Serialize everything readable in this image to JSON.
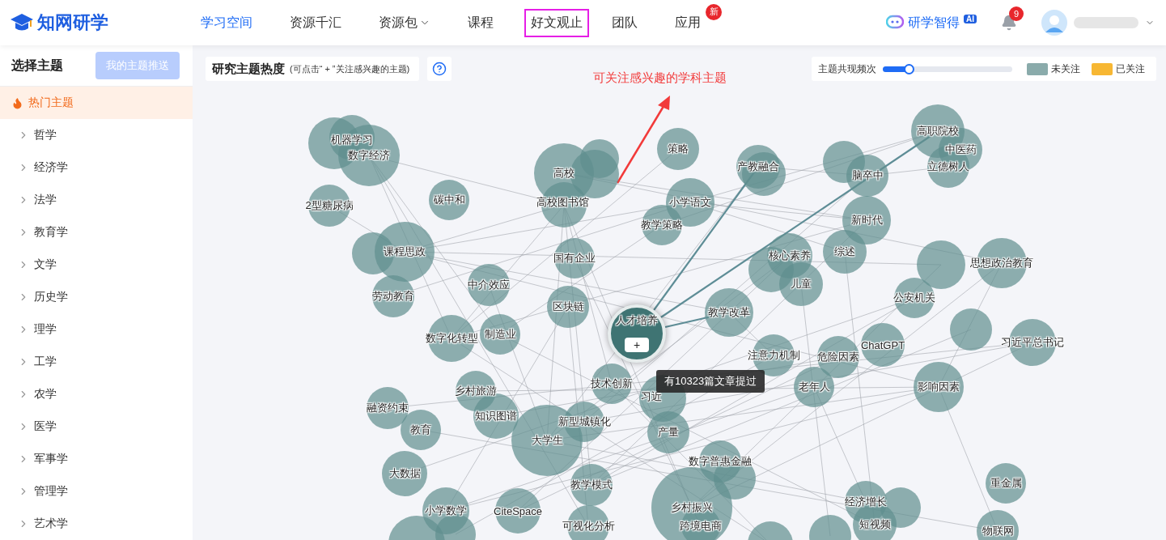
{
  "header": {
    "logo": "知网研学",
    "nav": [
      {
        "label": "学习空间",
        "selected": true,
        "outlined": false
      },
      {
        "label": "资源千汇",
        "selected": false,
        "outlined": false
      },
      {
        "label": "资源包",
        "selected": false,
        "outlined": false,
        "dropdown": true
      },
      {
        "label": "课程",
        "selected": false,
        "outlined": false
      },
      {
        "label": "好文观止",
        "selected": false,
        "outlined": true
      },
      {
        "label": "团队",
        "selected": false,
        "outlined": false
      },
      {
        "label": "应用",
        "selected": false,
        "outlined": false,
        "badge": "新"
      }
    ],
    "assistant": {
      "label": "研学智得",
      "badge": "AI"
    },
    "notifications": {
      "count": "9"
    }
  },
  "sidebar": {
    "title": "选择主题",
    "button": "我的主题推送",
    "items": [
      {
        "label": "热门主题",
        "selected": true,
        "kind": "hot"
      },
      {
        "label": "哲学",
        "selected": false,
        "kind": "category"
      },
      {
        "label": "经济学",
        "selected": false,
        "kind": "category"
      },
      {
        "label": "法学",
        "selected": false,
        "kind": "category"
      },
      {
        "label": "教育学",
        "selected": false,
        "kind": "category"
      },
      {
        "label": "文学",
        "selected": false,
        "kind": "category"
      },
      {
        "label": "历史学",
        "selected": false,
        "kind": "category"
      },
      {
        "label": "理学",
        "selected": false,
        "kind": "category"
      },
      {
        "label": "工学",
        "selected": false,
        "kind": "category"
      },
      {
        "label": "农学",
        "selected": false,
        "kind": "category"
      },
      {
        "label": "医学",
        "selected": false,
        "kind": "category"
      },
      {
        "label": "军事学",
        "selected": false,
        "kind": "category"
      },
      {
        "label": "管理学",
        "selected": false,
        "kind": "category"
      },
      {
        "label": "艺术学",
        "selected": false,
        "kind": "category"
      }
    ]
  },
  "graph": {
    "title": "研究主题热度",
    "hint": "(可点击“ + ”关注感兴趣的主题)",
    "slider": {
      "label": "主题共现频次",
      "level": 0.2
    },
    "legend": [
      {
        "label": "未关注",
        "color": "#8aabab"
      },
      {
        "label": "已关注",
        "color": "#f7b733"
      }
    ],
    "annotation": "可关注感兴趣的学科主题",
    "focus_node": {
      "label": "人才培养",
      "followed": false,
      "action": "+",
      "tooltip": "有10323篇文章提过"
    },
    "nodes": [
      {
        "label": "机器学习",
        "followed": false
      },
      {
        "followed": false
      },
      {
        "label": "数字经济",
        "followed": false
      },
      {
        "label": "2型糖尿病",
        "followed": false
      },
      {
        "label": "碳中和",
        "followed": false
      },
      {
        "label": "高校",
        "followed": false
      },
      {
        "followed": false
      },
      {
        "followed": false
      },
      {
        "label": "高校图书馆",
        "followed": false
      },
      {
        "label": "策略",
        "followed": false
      },
      {
        "label": "小学语文",
        "followed": false
      },
      {
        "label": "教学策略",
        "followed": false
      },
      {
        "label": "产教融合",
        "followed": false
      },
      {
        "followed": false
      },
      {
        "followed": false
      },
      {
        "label": "课程思政",
        "followed": false
      },
      {
        "label": "国有企业",
        "followed": false
      },
      {
        "label": "中介效应",
        "followed": false
      },
      {
        "label": "劳动教育",
        "followed": false
      },
      {
        "label": "区块链",
        "followed": false
      },
      {
        "label": "数字化转型",
        "followed": false
      },
      {
        "label": "制造业",
        "followed": false
      },
      {
        "label": "教学改革",
        "followed": false
      },
      {
        "followed": false
      },
      {
        "label": "核心素养",
        "followed": false
      },
      {
        "label": "儿童",
        "followed": false
      },
      {
        "followed": false
      },
      {
        "label": "脑卒中",
        "followed": false
      },
      {
        "label": "高职院校",
        "followed": false
      },
      {
        "label": "中医药",
        "followed": false
      },
      {
        "label": "立德树人",
        "followed": false
      },
      {
        "label": "新时代",
        "followed": false
      },
      {
        "label": "综述",
        "followed": false
      },
      {
        "followed": false
      },
      {
        "label": "思想政治教育",
        "followed": false
      },
      {
        "label": "公安机关",
        "followed": false
      },
      {
        "followed": false
      },
      {
        "label": "ChatGPT",
        "followed": false
      },
      {
        "label": "习近平总书记",
        "followed": false
      },
      {
        "label": "危险因素",
        "followed": false
      },
      {
        "label": "注意力机制",
        "followed": false
      },
      {
        "label": "乡村旅游",
        "followed": false
      },
      {
        "label": "技术创新",
        "followed": false
      },
      {
        "label": "习近",
        "followed": false
      },
      {
        "label": "老年人",
        "followed": false
      },
      {
        "label": "影响因素",
        "followed": false
      },
      {
        "label": "融资约束",
        "followed": false
      },
      {
        "label": "知识图谱",
        "followed": false
      },
      {
        "label": "教育",
        "followed": false
      },
      {
        "label": "大学生",
        "followed": false
      },
      {
        "label": "新型城镇化",
        "followed": false
      },
      {
        "label": "产量",
        "followed": false
      },
      {
        "label": "大数据",
        "followed": false
      },
      {
        "label": "教学模式",
        "followed": false
      },
      {
        "label": "数字普惠金融",
        "followed": false
      },
      {
        "followed": false
      },
      {
        "label": "重金属",
        "followed": false
      },
      {
        "label": "小学数学",
        "followed": false
      },
      {
        "followed": false
      },
      {
        "label": "CiteSpace",
        "followed": false
      },
      {
        "label": "可视化分析",
        "followed": false
      },
      {
        "label": "乡村振兴",
        "followed": false
      },
      {
        "label": "跨境电商",
        "followed": false
      },
      {
        "label": "经济增长",
        "followed": false
      },
      {
        "followed": false
      },
      {
        "label": "短视频",
        "followed": false
      },
      {
        "label": "物联网",
        "followed": false
      },
      {
        "followed": false
      },
      {
        "followed": false
      },
      {
        "followed": false
      }
    ]
  }
}
